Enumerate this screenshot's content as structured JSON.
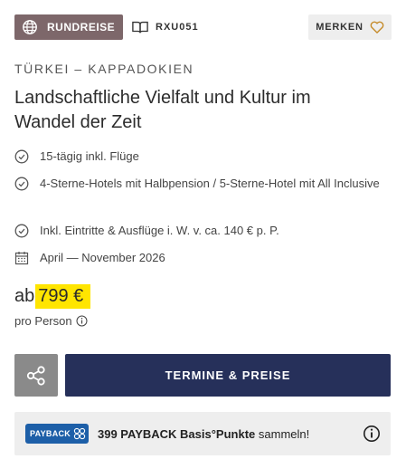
{
  "badge": {
    "label": "RUNDREISE",
    "icon": "globe-icon"
  },
  "trip_code": {
    "label": "RXU051",
    "icon": "book-icon"
  },
  "bookmark": {
    "label": "MERKEN",
    "icon": "heart-icon"
  },
  "region": "TÜRKEI – KAPPADOKIEN",
  "title": "Landschaftliche Vielfalt und Kultur im Wandel der Zeit",
  "features": [
    {
      "text": "15-tägig inkl. Flüge",
      "icon": "check-circle-icon"
    },
    {
      "text": "4-Sterne-Hotels mit Halbpension / 5-Sterne-Hotel mit All Inclusive",
      "icon": "check-circle-icon"
    },
    {
      "text": "Inkl. Eintritte & Ausflüge i. W. v. ca. 140 € p. P.",
      "icon": "check-circle-icon"
    },
    {
      "text": "April — November 2026",
      "icon": "calendar-icon"
    }
  ],
  "price": {
    "prefix": "ab",
    "value": "799 €",
    "per_person": "pro Person",
    "highlight": "#ffe500"
  },
  "actions": {
    "share_icon": "share-icon",
    "main_label": "TERMINE & PREISE",
    "main_color": "#26305a"
  },
  "payback": {
    "logo_text": "PAYBACK",
    "points_bold": "399 PAYBACK Basis°Punkte",
    "points_rest": " sammeln!",
    "info_icon": "info-icon"
  }
}
